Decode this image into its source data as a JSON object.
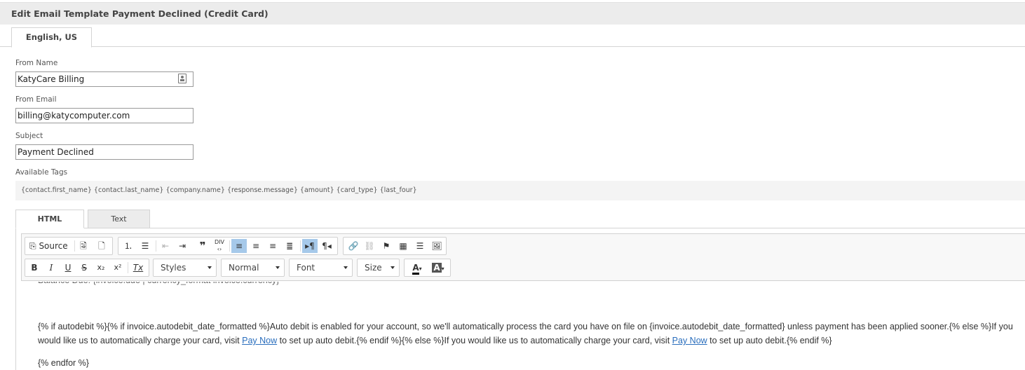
{
  "header": {
    "title": "Edit Email Template Payment Declined (Credit Card)"
  },
  "language_tab": {
    "label": "English, US"
  },
  "fields": {
    "from_name": {
      "label": "From Name",
      "value": "KatyCare Billing"
    },
    "from_email": {
      "label": "From Email",
      "value": "billing@katycomputer.com"
    },
    "subject": {
      "label": "Subject",
      "value": "Payment Declined"
    }
  },
  "available_tags": {
    "label": "Available Tags",
    "text": "{contact.first_name} {contact.last_name} {company.name} {response.message} {amount} {card_type} {last_four}"
  },
  "editor_tabs": {
    "html": "HTML",
    "text": "Text"
  },
  "toolbar": {
    "source_label": "Source",
    "styles": "Styles",
    "format": "Normal",
    "font": "Font",
    "size": "Size"
  },
  "content": {
    "cut_line": "Balance Due: {invoice.due | currency_format invoice.currency}",
    "para1_a": "{% if autodebit %}{% if invoice.autodebit_date_formatted %}Auto debit is enabled for your account, so we'll automatically process the card you have on file on {invoice.autodebit_date_formatted} unless payment has been applied sooner.{% else %}If you would like us to automatically charge your card, visit ",
    "link1": "Pay Now",
    "para1_b": " to set up auto debit.{% endif %}{% else %}If you would like us to automatically charge your card, visit ",
    "link2": "Pay Now",
    "para1_c": " to set up auto debit.{% endif %}",
    "para2": "{% endfor %}"
  }
}
